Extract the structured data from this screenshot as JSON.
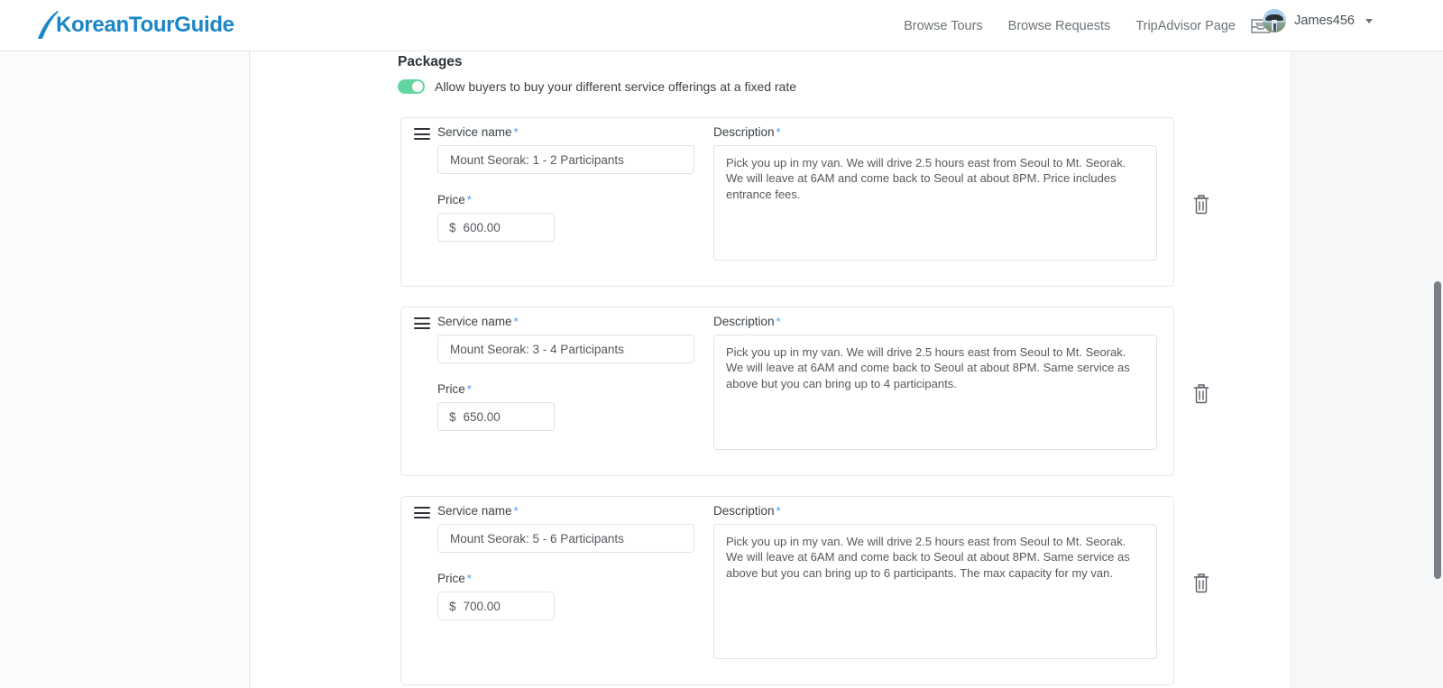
{
  "brand": {
    "logo_text": "KoreanTourGuide",
    "logo_color": "#1a86c8"
  },
  "nav": {
    "links": [
      {
        "label": "Browse Tours"
      },
      {
        "label": "Browse Requests"
      },
      {
        "label": "TripAdvisor Page"
      }
    ],
    "inbox_icon": "inbox-icon",
    "user": {
      "name": "James456",
      "avatar_icon": "user-avatar",
      "caret_icon": "chevron-down-icon"
    }
  },
  "main": {
    "section_title": "Packages",
    "toggle": {
      "enabled": true,
      "label": "Allow buyers to buy your different service offerings at a fixed rate",
      "on_color": "#62d6a0"
    },
    "labels": {
      "service_name": "Service name",
      "price": "Price",
      "description": "Description",
      "required_mark": "*",
      "currency": "$",
      "drag_handle_icon": "drag-handle-icon",
      "delete_icon": "trash-icon",
      "required_color": "#3f9bf5"
    },
    "packages": [
      {
        "service_name": "Mount Seorak: 1 - 2 Participants",
        "price": "600.00",
        "description": "Pick you up in my van. We will drive 2.5 hours east from Seoul to Mt. Seorak. We will leave at 6AM and come back to Seoul at about 8PM. Price includes entrance fees."
      },
      {
        "service_name": "Mount Seorak: 3 - 4 Participants",
        "price": "650.00",
        "description": "Pick you up in my van. We will drive 2.5 hours east from Seoul to Mt. Seorak. We will leave at 6AM and come back to Seoul at about 8PM. Same service as above but you can bring up to 4 participants."
      },
      {
        "service_name": "Mount Seorak: 5 - 6 Participants",
        "price": "700.00",
        "description": "Pick you up in my van. We will drive 2.5 hours east from Seoul to Mt. Seorak. We will leave at 6AM and come back to Seoul at about 8PM. Same service as above but you can bring up to 6 participants. The max capacity for my van."
      }
    ]
  },
  "layout": {
    "card_tops": [
      73,
      283,
      493
    ],
    "card_heights": [
      188,
      188,
      210
    ],
    "trash_tops": [
      158,
      368,
      578
    ]
  }
}
